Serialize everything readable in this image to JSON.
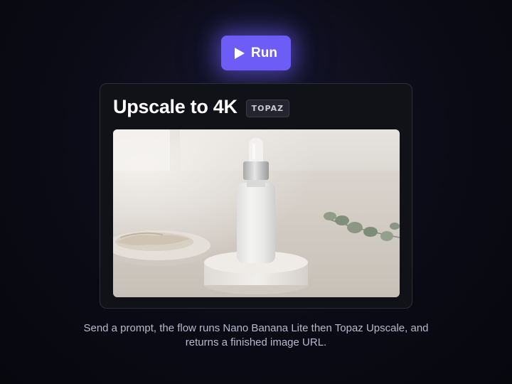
{
  "run_button": {
    "label": "Run",
    "icon": "play-icon",
    "accent": "#6e5cf6"
  },
  "card": {
    "title": "Upscale to 4K",
    "badge": "TOPAZ",
    "image": "product-photo-dropper-bottle"
  },
  "caption": {
    "line1": "Send a prompt, the flow runs Nano Banana Lite then Topaz Upscale, and",
    "line2": "returns a finished image URL."
  }
}
